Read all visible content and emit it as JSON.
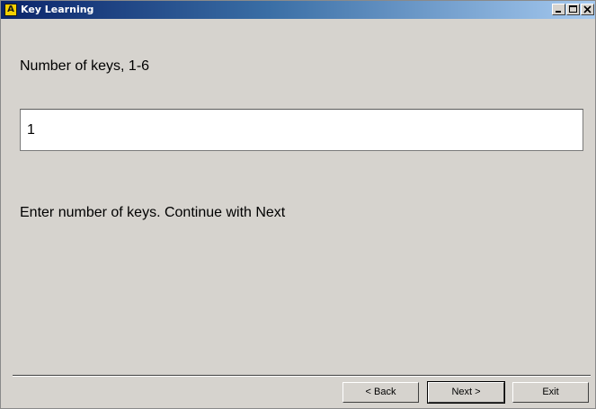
{
  "window": {
    "title": "Key Learning",
    "icon_letter": "A",
    "controls": {
      "minimize_icon": "minimize-icon",
      "maximize_icon": "maximize-icon",
      "close_icon": "close-icon"
    },
    "titlebar_colors": [
      "#0a246a",
      "#a6caf0"
    ]
  },
  "main": {
    "field_label": "Number of keys, 1-6",
    "field_value": "1",
    "instruction": "Enter number of keys. Continue with Next"
  },
  "buttons": {
    "back": "< Back",
    "next": "Next >",
    "exit": "Exit"
  }
}
